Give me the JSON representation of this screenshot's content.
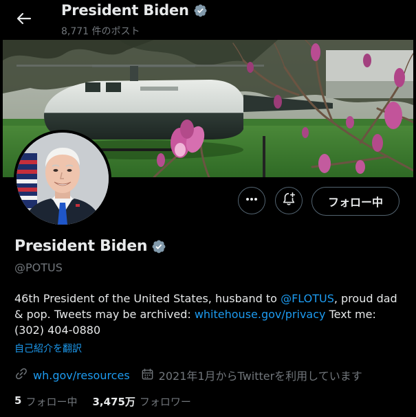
{
  "header": {
    "title": "President Biden",
    "post_count": "8,771 件のポスト"
  },
  "profile": {
    "name": "President Biden",
    "handle": "@POTUS",
    "bio": {
      "part1": "46th President of the United States, husband to ",
      "mention": "@FLOTUS",
      "part2": ", proud dad & pop. Tweets may be archived: ",
      "link": "whitehouse.gov/privacy",
      "part3": " Text me: (302) 404-0880"
    },
    "translate_label": "自己紹介を翻訳",
    "website": "wh.gov/resources",
    "joined": "2021年1月からTwitterを利用しています",
    "following_count": "5",
    "following_label": "フォロー中",
    "followers_count": "3,475万",
    "followers_label": "フォロワー"
  },
  "buttons": {
    "follow_label": "フォロー中",
    "more_icon": "more-icon",
    "notify_icon": "bell-plus-icon"
  },
  "colors": {
    "accent": "#1d9bf0",
    "muted": "#71767b",
    "verified": "#829aab"
  }
}
